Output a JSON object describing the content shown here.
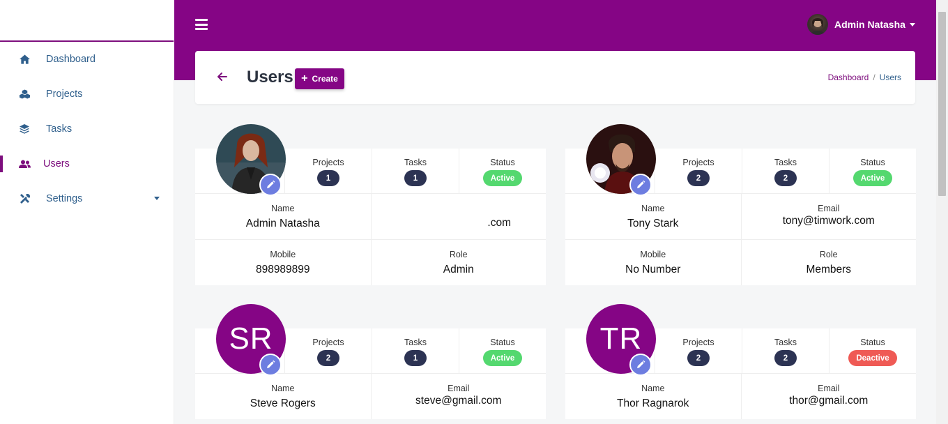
{
  "header": {
    "user_name": "Admin Natasha"
  },
  "sidebar": {
    "items": [
      {
        "label": "Dashboard",
        "icon": "home-icon"
      },
      {
        "label": "Projects",
        "icon": "cubes-icon"
      },
      {
        "label": "Tasks",
        "icon": "layers-icon"
      },
      {
        "label": "Users",
        "icon": "users-icon",
        "active": true
      },
      {
        "label": "Settings",
        "icon": "tools-icon",
        "has_submenu": true
      }
    ]
  },
  "page": {
    "title": "Users",
    "create_label": "Create",
    "breadcrumb": [
      "Dashboard",
      "Users"
    ]
  },
  "labels": {
    "projects": "Projects",
    "tasks": "Tasks",
    "status": "Status",
    "name": "Name",
    "email": "Email",
    "mobile": "Mobile",
    "role": "Role"
  },
  "users": [
    {
      "name": "Admin Natasha",
      "email": ".com",
      "mobile": "898989899",
      "role": "Admin",
      "projects": "1",
      "tasks": "1",
      "status": "Active",
      "avatar": "photo"
    },
    {
      "name": "Tony Stark",
      "email": "tony@timwork.com",
      "mobile": "No Number",
      "role": "Members",
      "projects": "2",
      "tasks": "2",
      "status": "Active",
      "avatar": "photo"
    },
    {
      "name": "Steve Rogers",
      "email": "steve@gmail.com",
      "projects": "2",
      "tasks": "1",
      "status": "Active",
      "initials": "SR"
    },
    {
      "name": "Thor Ragnarok",
      "email": "thor@gmail.com",
      "projects": "2",
      "tasks": "2",
      "status": "Deactive",
      "initials": "TR"
    }
  ],
  "colors": {
    "brand": "#850585",
    "active": "#54d86f",
    "deactive": "#ef5a55",
    "badge": "#2c3353",
    "edit": "#6d7de0"
  }
}
